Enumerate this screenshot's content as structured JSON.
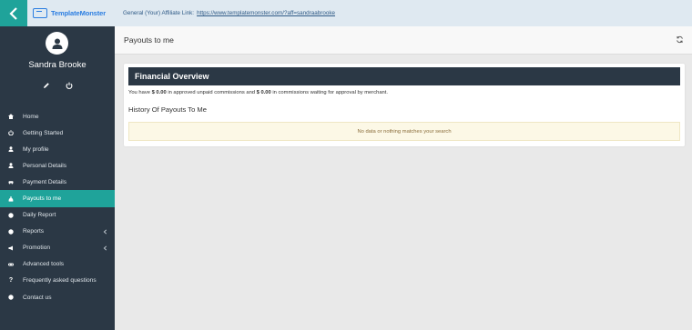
{
  "header": {
    "logo_text": "TemplateMonster",
    "affiliate_label": "General (Your) Affiliate Link:",
    "affiliate_link": "https://www.templatemonster.com/?aff=sandraabrooke"
  },
  "profile": {
    "name": "Sandra Brooke",
    "icons": [
      "pencil-icon",
      "power-icon"
    ]
  },
  "sidebar": {
    "items": [
      {
        "label": "Home",
        "icon": "home-icon"
      },
      {
        "label": "Getting Started",
        "icon": "power-icon"
      },
      {
        "label": "My profile",
        "icon": "user-icon"
      },
      {
        "label": "Personal Details",
        "icon": "user-icon"
      },
      {
        "label": "Payment Details",
        "icon": "car-icon"
      },
      {
        "label": "Payouts to me",
        "icon": "money-bag-icon",
        "active": true
      },
      {
        "label": "Daily Report",
        "icon": "globe-icon"
      },
      {
        "label": "Reports",
        "icon": "globe-icon",
        "has_submenu": true
      },
      {
        "label": "Promotion",
        "icon": "megaphone-icon",
        "has_submenu": true
      },
      {
        "label": "Advanced tools",
        "icon": "link-icon"
      },
      {
        "label": "Frequently asked questions",
        "icon": "question-icon"
      },
      {
        "label": "Contact us",
        "icon": "globe-icon"
      }
    ]
  },
  "page": {
    "title": "Payouts to me"
  },
  "panel": {
    "heading": "Financial Overview",
    "summary_prefix": "You have ",
    "approved_amount": "$ 0.00",
    "summary_middle": " in approved unpaid commissions and ",
    "pending_amount": "$ 0.00",
    "summary_suffix": " in commissions waiting for approval by merchant.",
    "history_title": "History Of Payouts To Me",
    "no_data": "No data or nothing matches your search"
  },
  "colors": {
    "sidebar_bg": "#2b3845",
    "accent": "#1fa39a",
    "topbar_bg": "#dfe9f1",
    "link": "#2f5a86",
    "notice_bg": "#fcf8e6"
  }
}
